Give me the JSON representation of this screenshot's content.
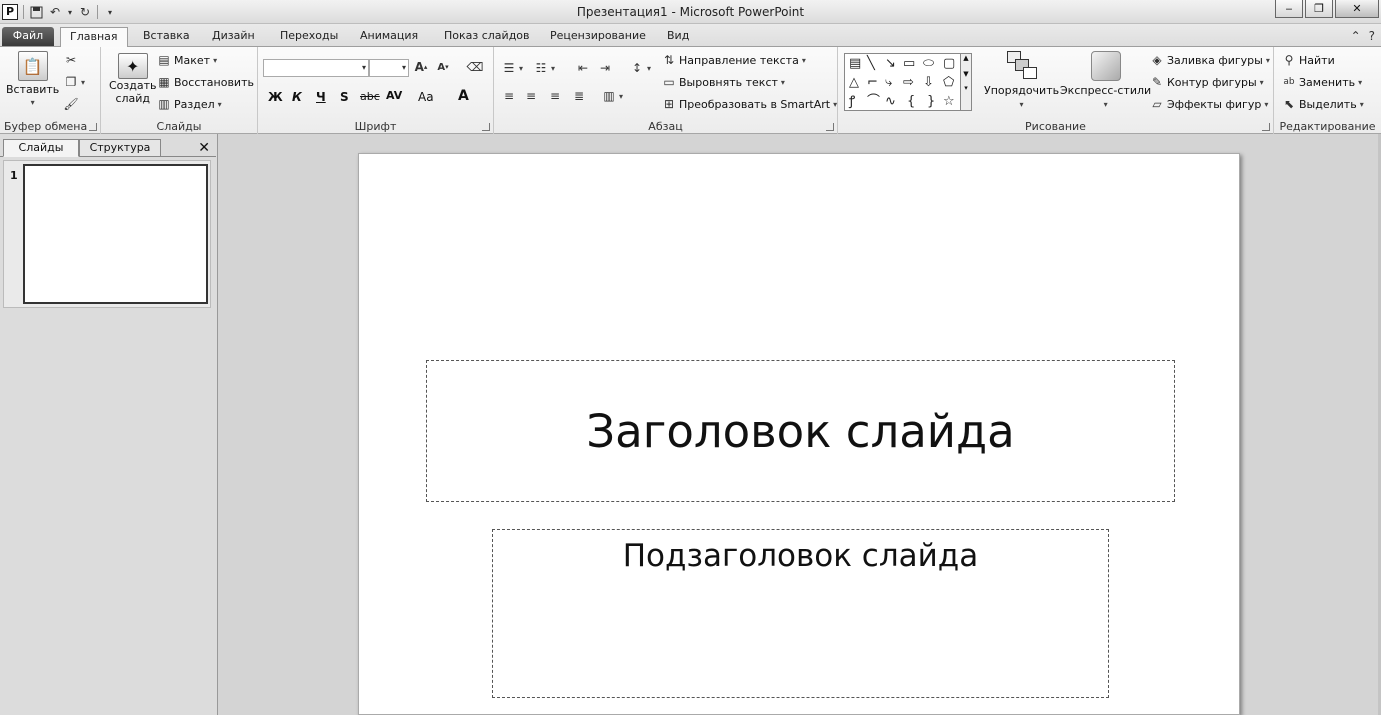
{
  "titlebar": {
    "title": "Презентация1 - Microsoft PowerPoint",
    "app_icon": "P"
  },
  "tabs": {
    "file": "Файл",
    "items": [
      "Главная",
      "Вставка",
      "Дизайн",
      "Переходы",
      "Анимация",
      "Показ слайдов",
      "Рецензирование",
      "Вид"
    ],
    "active": "Главная"
  },
  "ribbon": {
    "clipboard": {
      "paste": "Вставить",
      "label": "Буфер обмена"
    },
    "slides": {
      "new_slide_1": "Создать",
      "new_slide_2": "слайд",
      "layout": "Макет",
      "reset": "Восстановить",
      "section": "Раздел",
      "label": "Слайды"
    },
    "font": {
      "label": "Шрифт",
      "bold": "Ж",
      "italic": "К",
      "underline": "Ч",
      "shadow": "S",
      "strike": "abc",
      "spacing": "AV",
      "case": "Aa",
      "color": "A"
    },
    "paragraph": {
      "label": "Абзац",
      "text_direction": "Направление текста",
      "align_text": "Выровнять текст",
      "smartart": "Преобразовать в SmartArt"
    },
    "drawing": {
      "label": "Рисование",
      "arrange": "Упорядочить",
      "quick_styles": "Экспресс-стили",
      "fill": "Заливка фигуры",
      "outline": "Контур фигуры",
      "effects": "Эффекты фигур"
    },
    "editing": {
      "label": "Редактирование",
      "find": "Найти",
      "replace": "Заменить",
      "select": "Выделить"
    }
  },
  "leftpanel": {
    "tab_slides": "Слайды",
    "tab_outline": "Структура",
    "thumb_number": "1"
  },
  "slide": {
    "title": "Заголовок слайда",
    "subtitle": "Подзаголовок слайда"
  }
}
